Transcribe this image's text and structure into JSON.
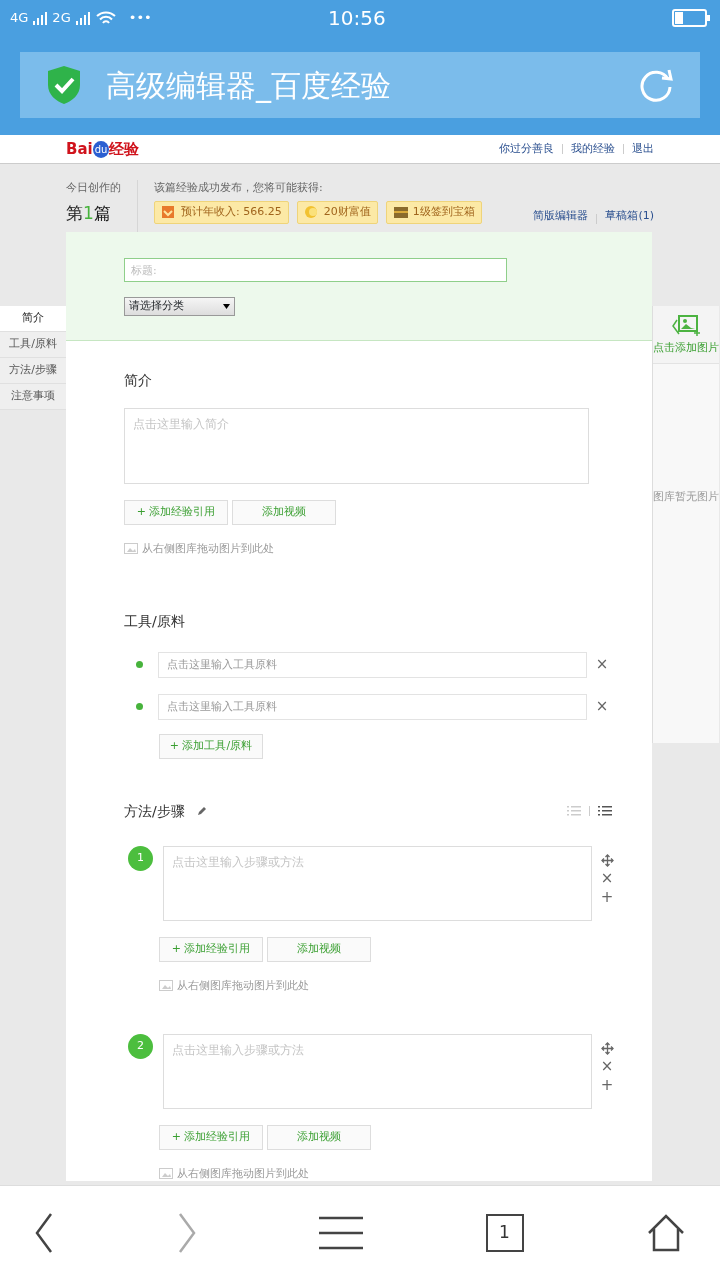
{
  "status_bar": {
    "network_1": "4G",
    "network_2": "2G",
    "more": "•••",
    "time": "10:56"
  },
  "address_bar": {
    "title": "高级编辑器_百度经验"
  },
  "site_header": {
    "logo": {
      "part_1": "Bai",
      "part_2": "du",
      "part_3": "经验"
    },
    "links": [
      "你过分善良",
      "我的经验",
      "退出"
    ]
  },
  "stats": {
    "label": "今日创作的",
    "count": {
      "prefix": "第",
      "number": "1",
      "suffix": "篇"
    },
    "reward_intro": "该篇经验成功发布，您将可能获得:",
    "rewards": [
      {
        "kind": "income",
        "text": "预计年收入: 566.25"
      },
      {
        "kind": "wealth",
        "text": "20财富值"
      },
      {
        "kind": "chest",
        "text": "1级签到宝箱"
      }
    ],
    "links": [
      "简版编辑器",
      "草稿箱(1)"
    ]
  },
  "title_field": {
    "placeholder": "标题:"
  },
  "category_select": {
    "value": "请选择分类"
  },
  "sidebar": {
    "items": [
      {
        "label": "简介",
        "selected": true
      },
      {
        "label": "工具/原料",
        "selected": false
      },
      {
        "label": "方法/步骤",
        "selected": false
      },
      {
        "label": "注意事项",
        "selected": false
      }
    ]
  },
  "intro": {
    "heading": "简介",
    "placeholder": "点击这里输入简介",
    "buttons": [
      "+ 添加经验引用",
      "添加视频"
    ],
    "hint": "从右侧图库拖动图片到此处"
  },
  "tools": {
    "heading": "工具/原料",
    "items": [
      {
        "placeholder": "点击这里输入工具原料",
        "remove": "×"
      },
      {
        "placeholder": "点击这里输入工具原料",
        "remove": "×"
      }
    ],
    "add_button": "+ 添加工具/原料"
  },
  "steps": {
    "heading": "方法/步骤",
    "items": [
      {
        "number": "1",
        "placeholder": "点击这里输入步骤或方法",
        "remove": "×",
        "insert": "+",
        "buttons": [
          "+ 添加经验引用",
          "添加视频"
        ],
        "hint": "从右侧图库拖动图片到此处"
      },
      {
        "number": "2",
        "placeholder": "点击这里输入步骤或方法",
        "remove": "×",
        "insert": "+",
        "buttons": [
          "+ 添加经验引用",
          "添加视频"
        ],
        "hint": "从右侧图库拖动图片到此处"
      }
    ]
  },
  "image_panel": {
    "add_label": "点击添加图片",
    "empty_text": "图库暂无图片"
  },
  "bottom_nav": {
    "tabs_count": "1"
  }
}
